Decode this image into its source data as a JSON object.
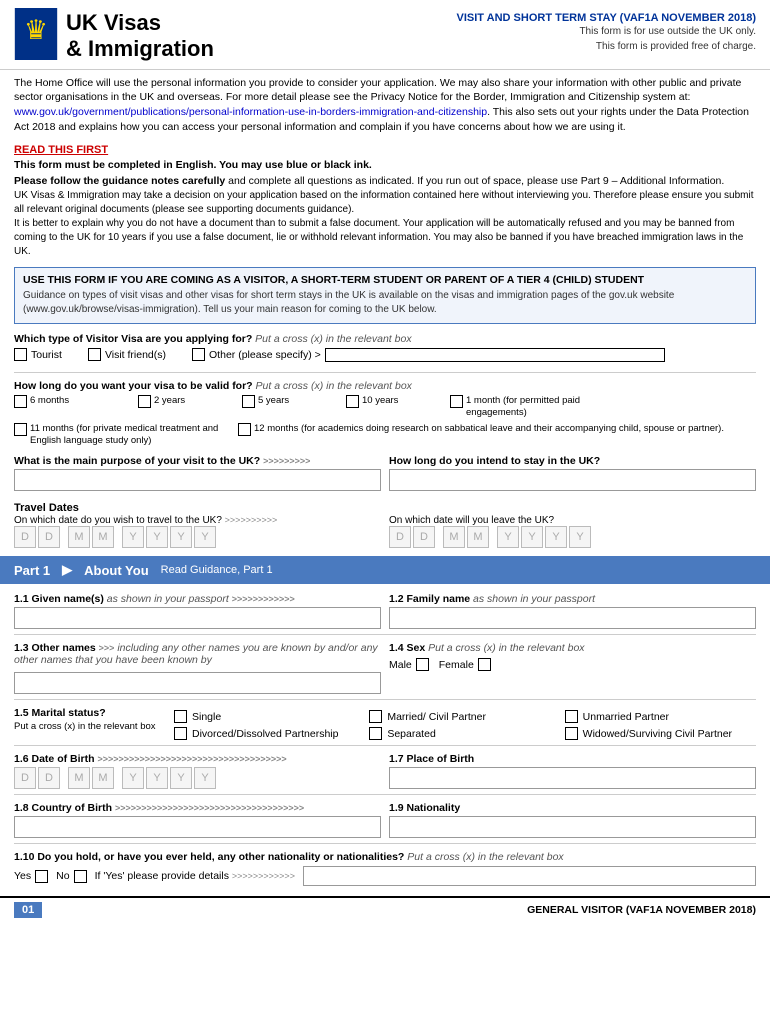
{
  "header": {
    "title_line1": "UK Visas",
    "title_line2": "& Immigration",
    "form_title": "VISIT AND SHORT TERM STAY (VAF1A NOVEMBER 2018)",
    "subtitle1": "This form is for use outside the UK only.",
    "subtitle2": "This form is provided free of charge."
  },
  "info_block": {
    "text": "The Home Office will use the personal information you provide to consider your application. We may also share your information with other public and private sector organisations in the UK and overseas. For more detail please see the Privacy Notice for the Border, Immigration and Citizenship system at: ",
    "link_text": "www.gov.uk/government/publications/personal-information-use-in-borders-immigration-and-citizenship",
    "text_after": ". This also sets out your rights under the Data Protection Act 2018 and explains how you can access your personal information and complain if you have concerns about how we are using it."
  },
  "read_first": {
    "title": "READ THIS FIRST",
    "line1": "This form must be completed in English. You may use blue or black ink.",
    "line2_bold": "Please follow the guidance notes carefully",
    "line2_rest": " and complete all questions as indicated. If you run out of space, please use Part 9 – Additional Information.",
    "line3": "UK Visas & Immigration may take a decision on your application based on the information contained here without interviewing you. Therefore please ensure you submit all relevant original documents (please see supporting documents guidance).",
    "line4": "It is better to explain why you do not have a document than to submit a false document. Your application will be automatically refused and you may be banned from coming to the UK for 10 years if you use a false document, lie or withhold relevant information. You may also be banned if you have breached immigration laws in the UK."
  },
  "blue_box": {
    "title": "USE THIS FORM IF YOU ARE COMING AS A VISITOR, A SHORT-TERM STUDENT OR PARENT OF A TIER 4 (CHILD) STUDENT",
    "body": "Guidance on types of visit visas and other visas for short term stays in the UK is available on the visas and immigration pages of the gov.uk website (www.gov.uk/browse/visas-immigration). Tell us your main reason for coming to the UK below."
  },
  "visitor_visa": {
    "question": "Which type of Visitor Visa are you applying for?",
    "instruction": "Put a cross (x) in the relevant box",
    "options": [
      "Tourist",
      "Visit friend(s)",
      "Other (please specify) >"
    ]
  },
  "visa_validity": {
    "question": "How long do you want your visa to be valid for?",
    "instruction": "Put a cross (x) in the relevant box",
    "options": [
      "6 months",
      "2 years",
      "5 years",
      "10 years",
      "1 month (for permitted paid engagements)",
      "11 months (for private medical treatment and English language study only)",
      "12 months (for academics doing research on sabbatical leave and their accompanying child, spouse or partner)."
    ]
  },
  "main_purpose": {
    "question": "What is the main purpose of your visit to the UK?",
    "arrows": ">>>>>>>>>"
  },
  "intend_stay": {
    "question": "How long do you intend to stay in the UK?"
  },
  "travel_dates": {
    "label": "Travel Dates",
    "depart_q": "On which date do you wish to travel to the UK?",
    "depart_arrows": ">>>>>>>>>>",
    "leave_q": "On which date will you leave the UK?",
    "date_placeholders": [
      "D",
      "D",
      "M",
      "M",
      "Y",
      "Y",
      "Y",
      "Y"
    ]
  },
  "part1": {
    "label": "Part 1",
    "title": "About You",
    "guidance": "Read Guidance, Part 1"
  },
  "field_1_1": {
    "label": "1.1  Given name(s)",
    "italic": "as shown in your passport",
    "arrows": ">>>>>>>>>>>>"
  },
  "field_1_2": {
    "label": "1.2  Family name",
    "italic": "as shown in your passport"
  },
  "field_1_3": {
    "label": "1.3  Other names",
    "italic": "including any other names you are known by and/or any other names that you have been known by",
    "arrows": ">>>"
  },
  "field_1_4": {
    "label": "1.4  Sex",
    "italic": "Put a cross (x) in the relevant box",
    "options": [
      "Male",
      "Female"
    ]
  },
  "field_1_5": {
    "label": "1.5  Marital status?",
    "sub_label": "Put a cross (x) in the relevant box",
    "options": [
      "Single",
      "Married/ Civil Partner",
      "Unmarried Partner",
      "Divorced/Dissolved Partnership",
      "Separated",
      "Widowed/Surviving Civil Partner"
    ]
  },
  "field_1_6": {
    "label": "1.6  Date of Birth",
    "arrows": ">>>>>>>>>>>>>>>>>>>>>>>>>>>>>>>>>>>>"
  },
  "field_1_7": {
    "label": "1.7  Place of Birth"
  },
  "field_1_8": {
    "label": "1.8  Country of Birth",
    "arrows": ">>>>>>>>>>>>>>>>>>>>>>>>>>>>>>>>>>>>"
  },
  "field_1_9": {
    "label": "1.9  Nationality"
  },
  "field_1_10": {
    "label": "1.10  Do you hold, or have you ever held, any other nationality or nationalities?",
    "instruction": "Put a cross (x) in the relevant box",
    "options": [
      "Yes",
      "No"
    ],
    "if_yes": "If 'Yes' please provide details",
    "arrows": ">>>>>>>>>>>>"
  },
  "footer": {
    "page": "01",
    "right_text": "GENERAL VISITOR (VAF1A NOVEMBER 2018)"
  }
}
